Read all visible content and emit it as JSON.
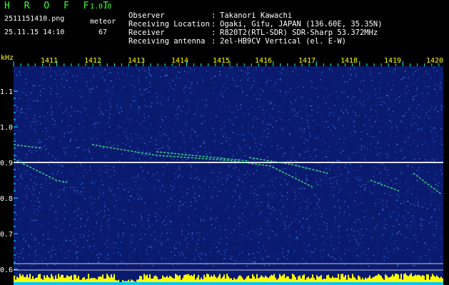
{
  "header": {
    "title": "H R O F F T",
    "version": "1.0.0",
    "filename": "2511151410.png",
    "meteor_label": "meteor",
    "datetime": "25.11.15 14:10",
    "meteor_count": "67"
  },
  "info": {
    "rows": [
      {
        "key": "Observer",
        "sep": ":",
        "value": "Takanori Kawachi"
      },
      {
        "key": "Receiving Location",
        "sep": ":",
        "value": "Ogaki, Gifu, JAPAN (136.60E, 35.35N)"
      },
      {
        "key": "Receiver",
        "sep": ":",
        "value": "R820T2(RTL-SDR) SDR-Sharp 53.372MHz"
      },
      {
        "key": "Receiving antenna",
        "sep": ":",
        "value": "2el-HB9CV Vertical (el. E-W)"
      }
    ]
  },
  "axis": {
    "unit": "kHz",
    "y_ticks": [
      "1.1",
      "1.0",
      "0.9",
      "0.8",
      "0.7",
      "0.6"
    ],
    "x_ticks": [
      "1411",
      "1412",
      "1413",
      "1414",
      "1415",
      "1416",
      "1417",
      "1418",
      "1419",
      "1420"
    ]
  },
  "colors": {
    "background": "#000000",
    "spectrum_bg": "#0a1a6e",
    "title": "#3cff3c",
    "axis_labels": "#ffff00",
    "grid": "#00ffff",
    "signal": "#e0e0ff",
    "meteor_trail": "#40ff80",
    "level_bar": "#ffff00"
  }
}
